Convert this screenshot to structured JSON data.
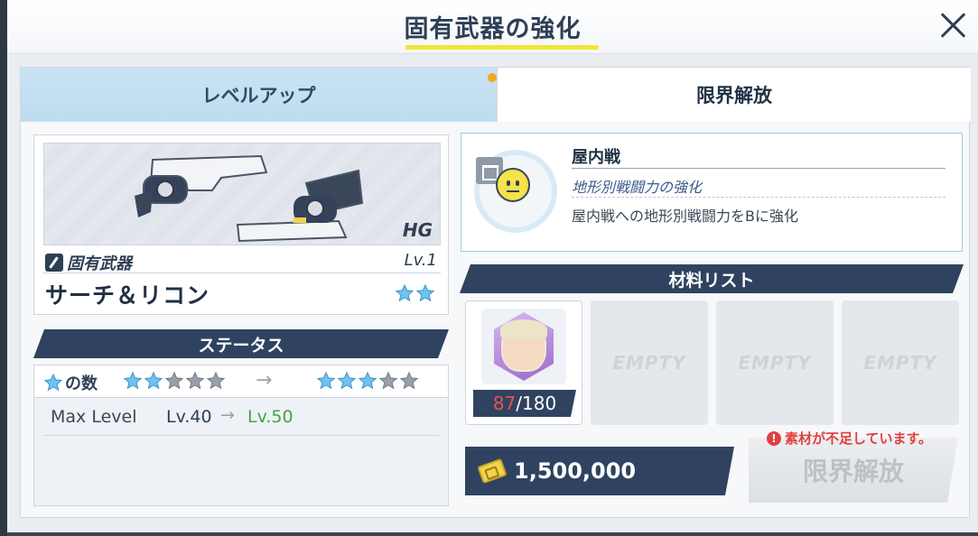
{
  "header": {
    "title": "固有武器の強化",
    "close_label": "✕"
  },
  "tabs": [
    {
      "label": "レベルアップ",
      "active": false
    },
    {
      "label": "限界解放",
      "active": true
    }
  ],
  "weapon": {
    "class": "HG",
    "type_label": "固有武器",
    "level": "Lv.1",
    "name": "サーチ＆リコン",
    "stars": 2
  },
  "status": {
    "header": "ステータス",
    "star_label": "の数",
    "stars_before": 2,
    "stars_after": 3,
    "stars_total": 5,
    "arrow": "→",
    "max_level_label": "Max Level",
    "max_level_from": "Lv.40",
    "max_level_arrow": "→",
    "max_level_to": "Lv.50"
  },
  "skill": {
    "title": "屋内戦",
    "subtitle": "地形別戦闘力の強化",
    "description": "屋内戦への地形別戦闘力をBに強化"
  },
  "materials": {
    "header": "材料リスト",
    "items": [
      {
        "have": "87",
        "need": "/180"
      }
    ],
    "empty_label": "EMPTY"
  },
  "cost": {
    "value": "1,500,000"
  },
  "warning": "素材が不足しています。",
  "action_button": "限界解放",
  "colors": {
    "navy": "#2f4360",
    "tab_inactive": "#c9e3f4",
    "star_active": "#6ec3ef",
    "star_inactive": "#9aa0a8",
    "warning": "#e04040",
    "level_up": "#3fa640"
  }
}
